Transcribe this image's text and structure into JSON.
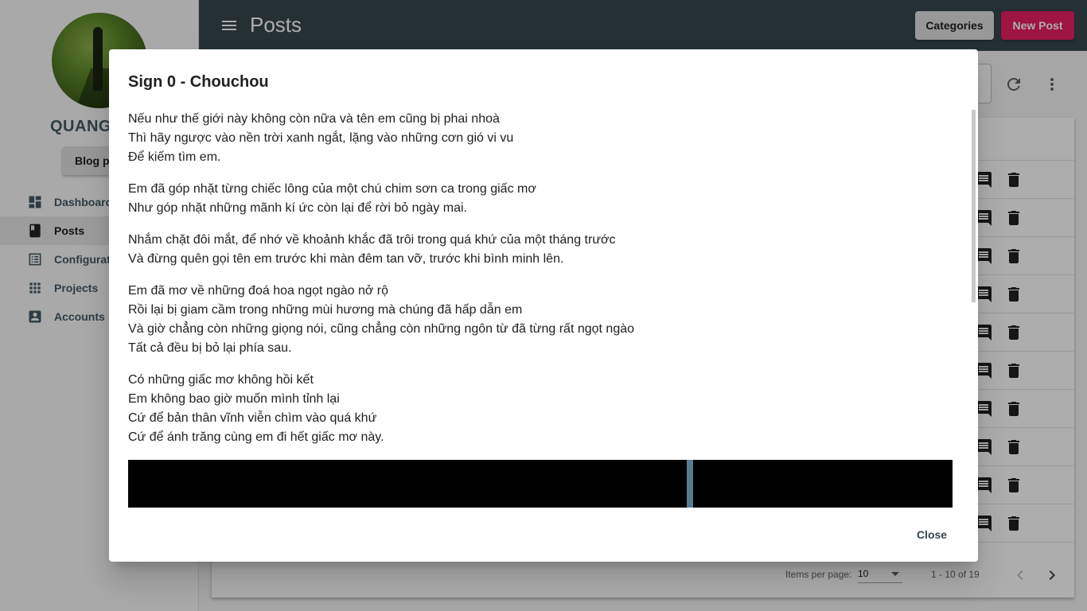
{
  "sidebar": {
    "site_name": "QUANG",
    "blog_button": "Blog pa",
    "items": [
      {
        "label": "Dashboard",
        "icon": "dashboard-icon"
      },
      {
        "label": "Posts",
        "icon": "book-icon",
        "active": true
      },
      {
        "label": "Configurati",
        "icon": "list-icon"
      },
      {
        "label": "Projects",
        "icon": "apps-grid-icon"
      },
      {
        "label": "Accounts",
        "icon": "account-box-icon"
      }
    ]
  },
  "header": {
    "title": "Posts",
    "categories_label": "Categories",
    "new_post_label": "New Post"
  },
  "paginator": {
    "items_per_page_label": "Items per page:",
    "items_per_page_value": "10",
    "range_label": "1 - 10 of 19"
  },
  "dialog": {
    "title": "Sign 0 - Chouchou",
    "stanzas": [
      [
        "Nếu như thế giới này không còn nữa và tên em cũng bị phai nhoà",
        "Thì hãy ngược vào nền trời xanh ngắt, lặng vào những cơn gió vi vu",
        "Để kiếm tìm em."
      ],
      [
        "Em đã góp nhặt từng chiếc lông của một chú chim sơn ca trong giấc mơ",
        "Như góp nhặt những mãnh kí ức còn lại để rời bỏ ngày mai."
      ],
      [
        "Nhắm chặt đôi mắt, để nhớ về khoảnh khắc đã trôi trong quá khứ của một tháng trước",
        "Và đừng quên gọi tên em trước khi màn đêm tan vỡ, trước khi bình minh lên."
      ],
      [
        "Em đã mơ về những đoá hoa ngọt ngào nở rộ",
        "Rồi lại bị giam cầm trong những mùi hương mà chúng đã hấp dẫn em",
        "Và giờ chẳng còn những giọng nói, cũng chẳng còn những ngôn từ đã từng rất ngọt ngào",
        "Tất cả đều bị bỏ lại phía sau."
      ],
      [
        "Có những giấc mơ không hồi kết",
        "Em không bao giờ muốn mình tỉnh lại",
        "Cứ để bản thân vĩnh viễn chìm vào quá khứ",
        "Cứ để ánh trăng cùng em đi hết giấc mơ này."
      ]
    ],
    "close_label": "Close"
  },
  "colors": {
    "topbar": "#37474f",
    "accent": "#e91e63",
    "backdrop": "rgba(0,0,0,0.32)"
  }
}
